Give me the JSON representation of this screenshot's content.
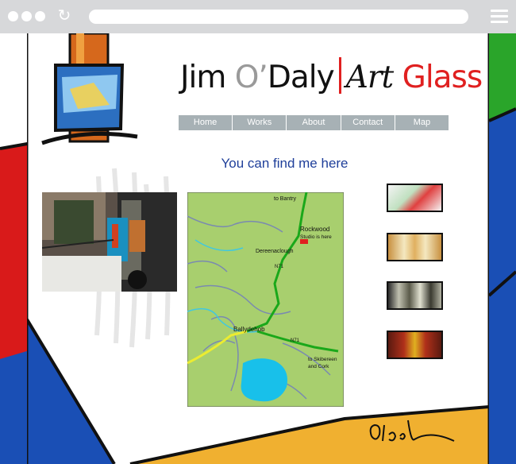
{
  "browser": {
    "address": "",
    "reload_icon": "reload-icon",
    "menu_icon": "hamburger-menu-icon"
  },
  "site": {
    "title_first": "Jim ",
    "title_o": "O’",
    "title_daly": "Daly",
    "title_art": "Art",
    "title_glass": "Glass",
    "colors": {
      "accent_red": "#e02020",
      "heading_blue": "#1f3f9a",
      "nav_grey": "#a7b1b5"
    }
  },
  "nav": {
    "items": [
      "Home",
      "Works",
      "About",
      "Contact",
      "Map"
    ]
  },
  "main": {
    "heading": "You can find me here"
  },
  "map": {
    "to_bantry": "to Bantry",
    "rockwood": "Rockwood",
    "studio": "Studio is here",
    "dereenaclough": "Dereenaclough",
    "n71_top": "N71",
    "ballydehob": "Ballydehob",
    "n71_bottom": "N71",
    "to_skibereen": "to Skibereen",
    "and_cork": "and Cork"
  }
}
